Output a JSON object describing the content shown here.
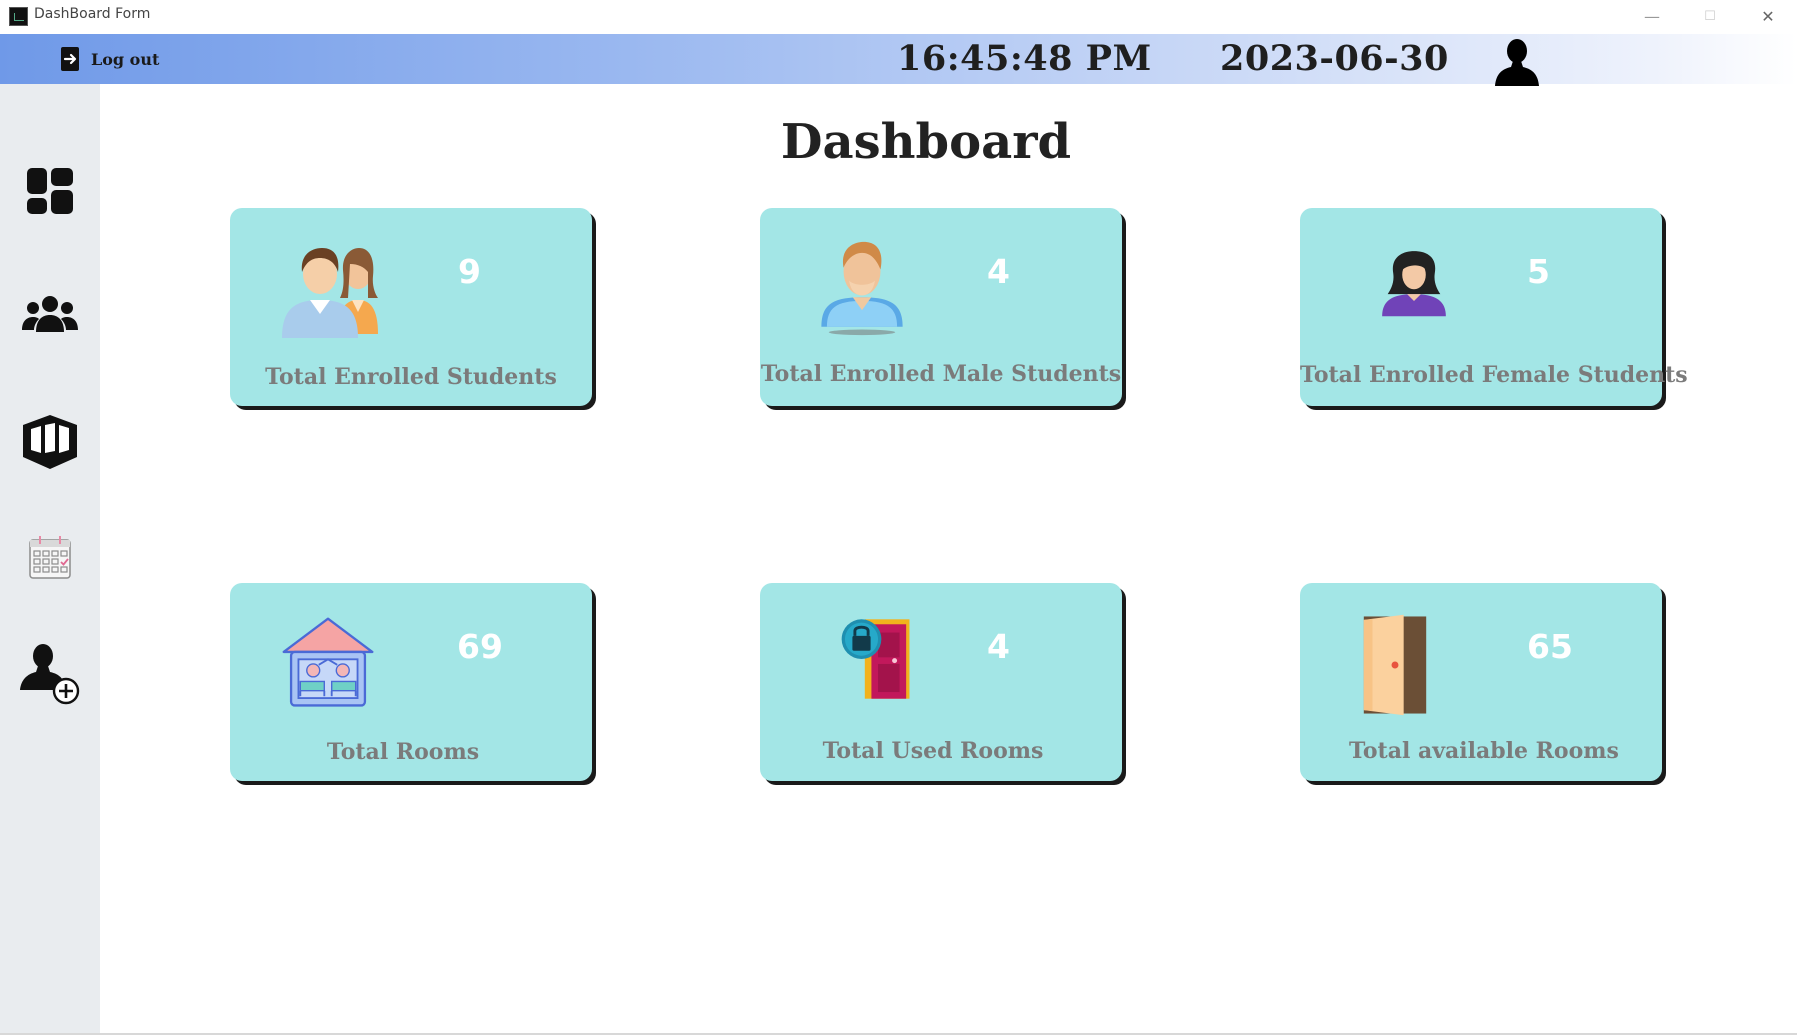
{
  "window": {
    "title": "DashBoard Form",
    "controls": {
      "minimize": "—",
      "maximize": "☐",
      "close": "✕"
    }
  },
  "header": {
    "logout_label": "Log out",
    "time": "16:45:48 PM",
    "date": "2023-06-30",
    "avatar_icon": "user-silhouette-icon"
  },
  "sidebar": {
    "items": [
      {
        "name": "dashboard",
        "icon": "dashboard-grid-icon"
      },
      {
        "name": "students",
        "icon": "users-group-icon"
      },
      {
        "name": "rooms",
        "icon": "room-box-icon"
      },
      {
        "name": "calendar",
        "icon": "calendar-icon"
      },
      {
        "name": "add-user",
        "icon": "add-user-icon"
      }
    ]
  },
  "main": {
    "title": "Dashboard",
    "cards": [
      {
        "label": "Total Enrolled Students",
        "count": "9",
        "icon": "students-pair-icon"
      },
      {
        "label": "Total Enrolled Male Students",
        "count": "4",
        "icon": "male-student-icon"
      },
      {
        "label": "Total Enrolled Female Students",
        "count": "5",
        "icon": "female-student-icon"
      },
      {
        "label": "Total Rooms",
        "count": "69",
        "icon": "dorm-house-icon"
      },
      {
        "label": "Total Used Rooms",
        "count": "4",
        "icon": "locked-door-icon"
      },
      {
        "label": "Total available Rooms",
        "count": "65",
        "icon": "open-door-icon"
      }
    ]
  },
  "colors": {
    "card_background": "#a3e6e6",
    "card_count": "#ffffff",
    "card_label": "#7b7b7b",
    "header_gradient_start": "#6f99e8",
    "sidebar_background": "#e9ecef"
  }
}
